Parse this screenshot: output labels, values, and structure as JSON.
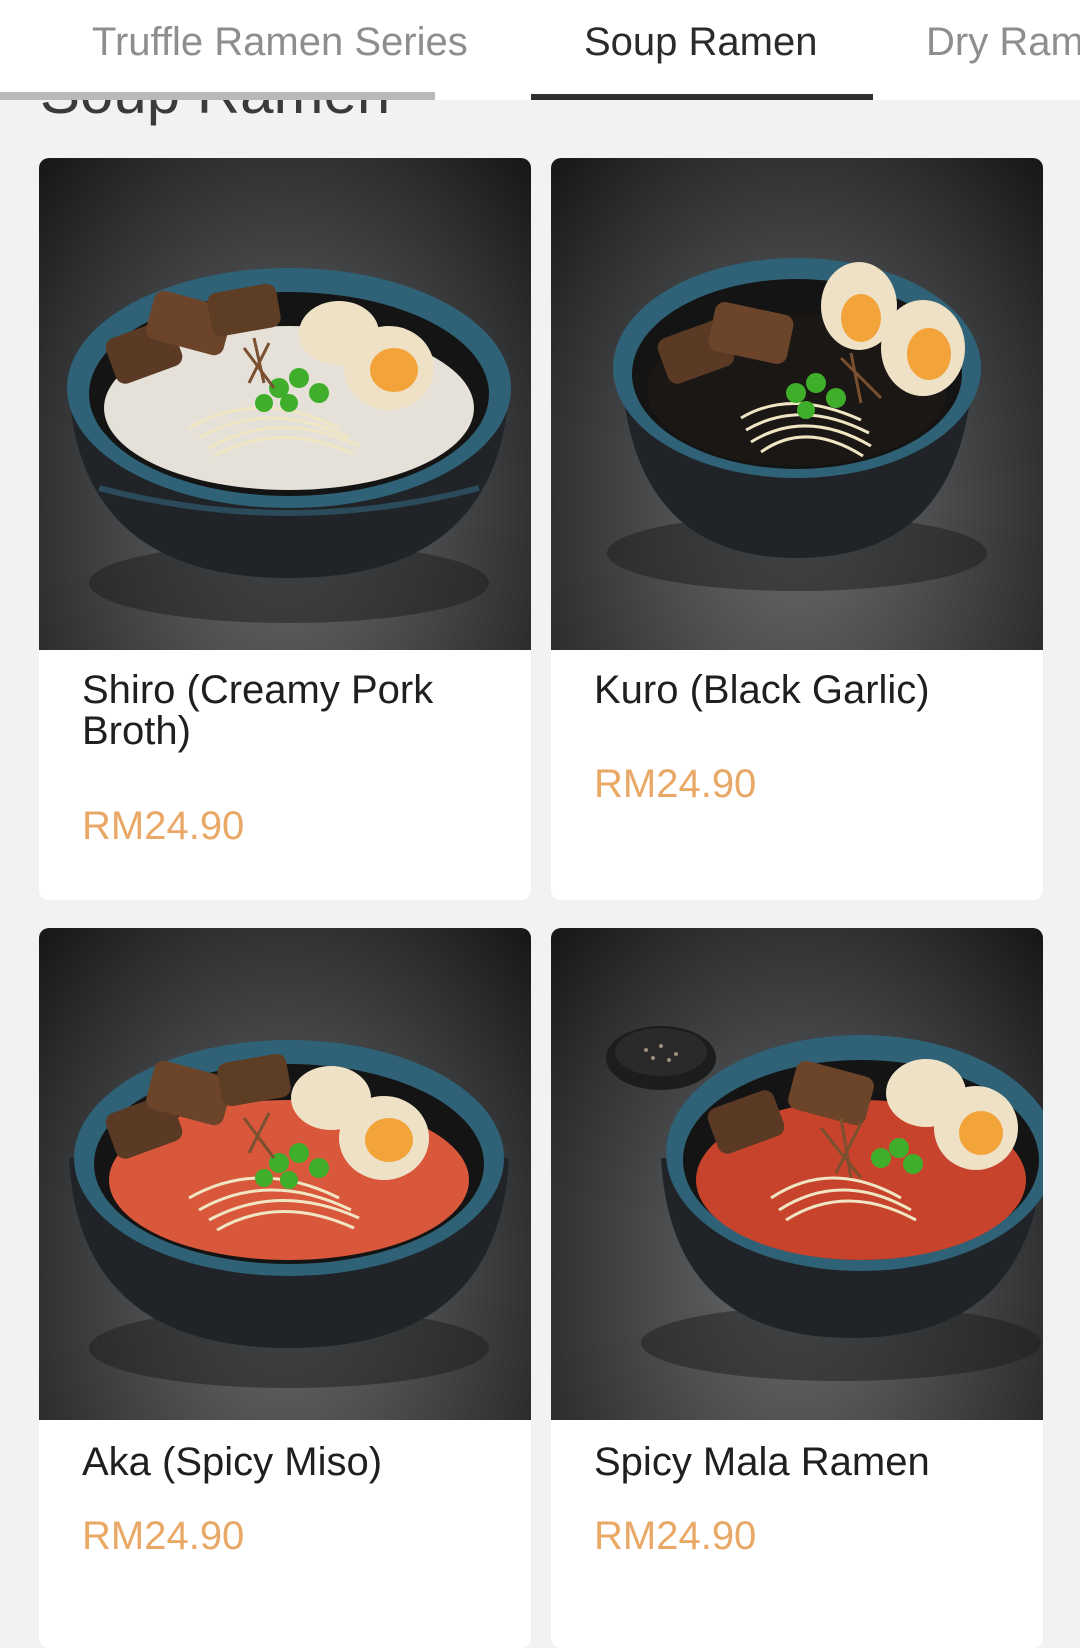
{
  "tabs": [
    {
      "label": "Truffle Ramen Series",
      "active": false
    },
    {
      "label": "Soup Ramen",
      "active": true
    },
    {
      "label": "Dry Ramen",
      "active": false
    }
  ],
  "section_heading": "Soup Ramen",
  "colors": {
    "accent_price": "#e9a866",
    "tab_active": "#2b2b2b",
    "tab_inactive": "#8e8e8e"
  },
  "items": [
    {
      "name": "Shiro (Creamy Pork Broth)",
      "price": "RM24.90",
      "broth_color": "#e6e1d8",
      "image_icon": "ramen-bowl-icon"
    },
    {
      "name": "Kuro (Black Garlic)",
      "price": "RM24.90",
      "broth_color": "#1b1714",
      "image_icon": "ramen-bowl-icon"
    },
    {
      "name": "Aka (Spicy Miso)",
      "price": "RM24.90",
      "broth_color": "#d9573a",
      "image_icon": "ramen-bowl-icon"
    },
    {
      "name": "Spicy Mala Ramen",
      "price": "RM24.90",
      "broth_color": "#c8432c",
      "image_icon": "ramen-bowl-icon"
    }
  ]
}
